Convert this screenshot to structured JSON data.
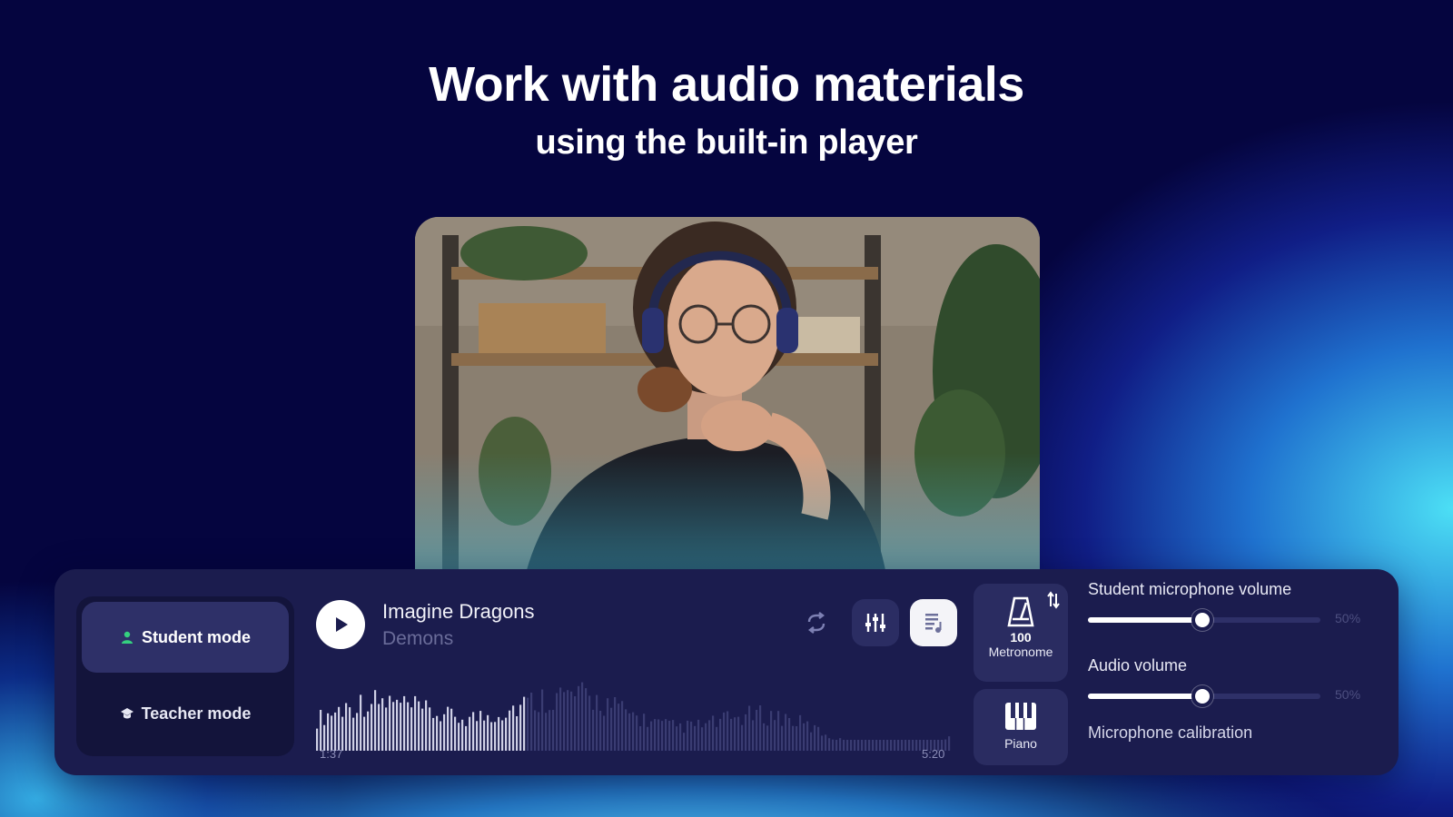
{
  "hero": {
    "title": "Work with audio materials",
    "subtitle": "using the built-in player"
  },
  "modes": {
    "student_label": "Student mode",
    "teacher_label": "Teacher mode",
    "active": "student"
  },
  "track": {
    "artist": "Imagine Dragons",
    "title": "Demons",
    "time_current": "1:37",
    "time_total": "5:20",
    "progress": 0.33
  },
  "tools": {
    "metronome_bpm": "100",
    "metronome_label": "Metronome",
    "piano_label": "Piano"
  },
  "sliders": {
    "mic_volume_label": "Student microphone volume",
    "mic_volume_value": "50%",
    "audio_volume_label": "Audio volume",
    "audio_volume_value": "50%"
  },
  "mic_calibration_label": "Microphone calibration",
  "icons": {
    "play": "play-icon",
    "repeat": "repeat-icon",
    "equalizer": "equalizer-icon",
    "lyrics": "lyrics-icon",
    "metronome": "metronome-icon",
    "piano": "piano-icon",
    "swap": "swap-icon",
    "student": "person-icon",
    "teacher": "teacher-icon"
  },
  "colors": {
    "background": "#05053f",
    "panel": "#1b1c4e",
    "accent_green": "#35d07f"
  }
}
